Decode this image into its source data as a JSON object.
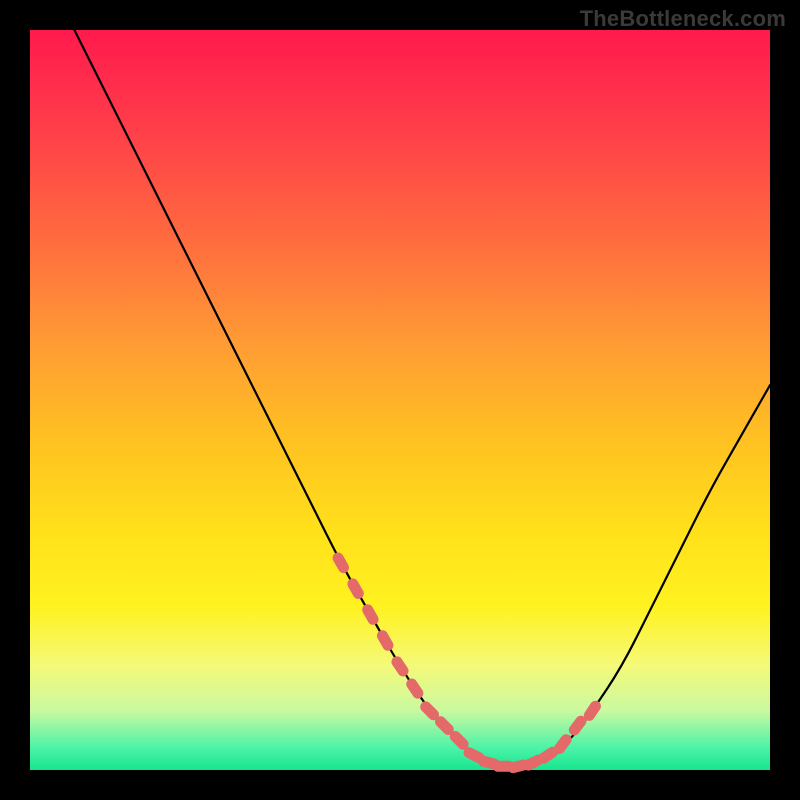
{
  "watermark": {
    "text": "TheBottleneck.com"
  },
  "colors": {
    "page_bg": "#000000",
    "curve_stroke": "#000000",
    "marker_fill": "#e46a6a",
    "marker_stroke": "#c94d4d"
  },
  "chart_data": {
    "type": "line",
    "title": "",
    "xlabel": "",
    "ylabel": "",
    "xlim": [
      0,
      100
    ],
    "ylim": [
      0,
      100
    ],
    "grid": false,
    "legend": false,
    "series": [
      {
        "name": "bottleneck-curve",
        "x": [
          6,
          10,
          14,
          18,
          22,
          26,
          30,
          34,
          38,
          42,
          46,
          50,
          54,
          56,
          58,
          60,
          62,
          64,
          66,
          68,
          70,
          73,
          76,
          80,
          84,
          88,
          92,
          96,
          100
        ],
        "y": [
          100,
          92,
          84,
          76,
          68,
          60,
          52,
          44,
          36,
          28,
          21,
          14,
          8,
          6,
          4,
          2,
          1,
          0.5,
          0.5,
          1,
          2,
          4,
          8,
          14,
          22,
          30,
          38,
          45,
          52
        ]
      }
    ],
    "markers": {
      "name": "highlighted-points",
      "x": [
        42,
        44,
        46,
        48,
        50,
        52,
        54,
        56,
        58,
        60,
        62,
        64,
        66,
        68,
        70,
        72,
        74,
        76
      ],
      "y": [
        28,
        24.5,
        21,
        17.5,
        14,
        11,
        8,
        6,
        4,
        2,
        1,
        0.5,
        0.5,
        1,
        2,
        3.5,
        6,
        8
      ]
    }
  }
}
